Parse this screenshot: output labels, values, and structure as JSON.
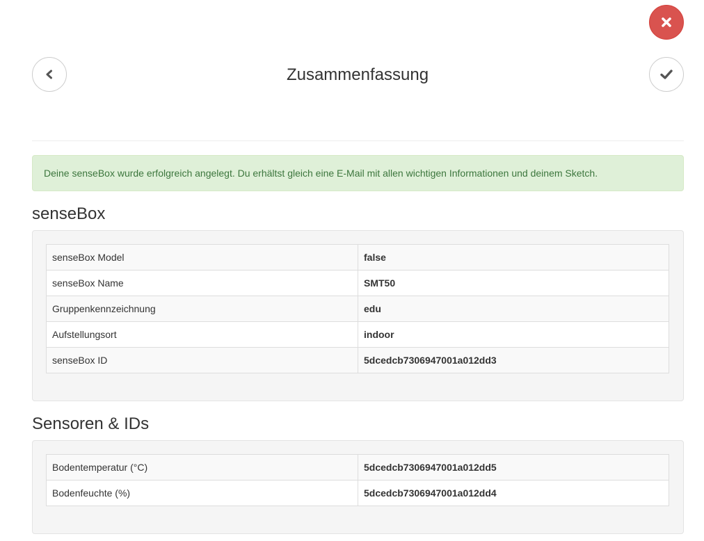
{
  "header": {
    "title": "Zusammenfassung",
    "close_icon": "times-icon",
    "back_icon": "chevron-left-icon",
    "confirm_icon": "check-icon"
  },
  "alert": {
    "message": "Deine senseBox wurde erfolgreich angelegt. Du erhältst gleich eine E-Mail mit allen wichtigen Informationen und deinem Sketch.",
    "color": "#3c763d"
  },
  "sensebox": {
    "heading": "senseBox",
    "rows": [
      {
        "label": "senseBox Model",
        "value": "false"
      },
      {
        "label": "senseBox Name",
        "value": "SMT50"
      },
      {
        "label": "Gruppenkennzeichnung",
        "value": "edu"
      },
      {
        "label": "Aufstellungsort",
        "value": "indoor"
      },
      {
        "label": "senseBox ID",
        "value": "5dcedcb7306947001a012dd3"
      }
    ]
  },
  "sensors": {
    "heading": "Sensoren & IDs",
    "rows": [
      {
        "label": "Bodentemperatur (°C)",
        "value": "5dcedcb7306947001a012dd5"
      },
      {
        "label": "Bodenfeuchte (%)",
        "value": "5dcedcb7306947001a012dd4"
      }
    ]
  },
  "colors": {
    "close_button": "#d9534f",
    "alert_background": "#dff0d8"
  }
}
